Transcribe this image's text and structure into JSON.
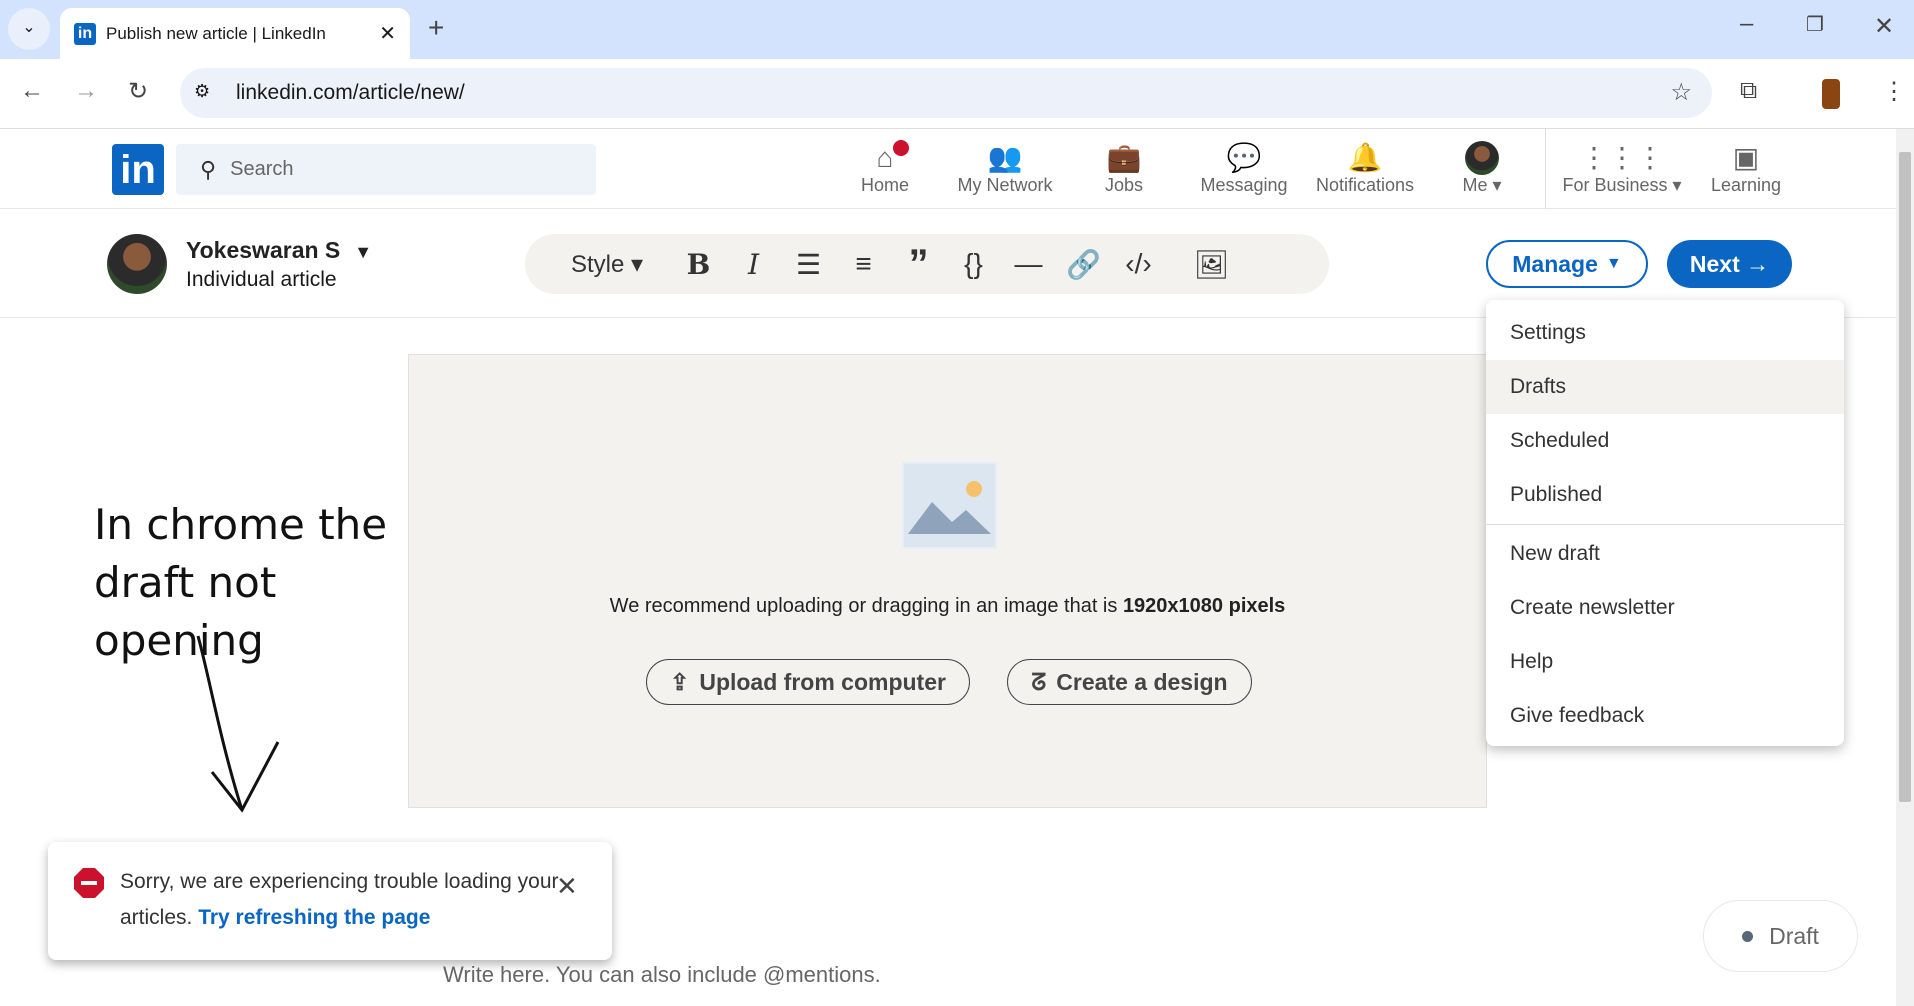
{
  "browser": {
    "tab_title": "Publish new article | LinkedIn",
    "url": "linkedin.com/article/new/"
  },
  "nav": {
    "search_placeholder": "Search",
    "items": [
      {
        "label": "Home"
      },
      {
        "label": "My Network"
      },
      {
        "label": "Jobs"
      },
      {
        "label": "Messaging"
      },
      {
        "label": "Notifications"
      },
      {
        "label": "Me"
      },
      {
        "label": "For Business"
      },
      {
        "label": "Learning"
      }
    ]
  },
  "author": {
    "name": "Yokeswaran S",
    "type": "Individual article"
  },
  "toolbar": {
    "style_label": "Style"
  },
  "actions": {
    "manage": "Manage",
    "next": "Next"
  },
  "manage_menu": [
    "Settings",
    "Drafts",
    "Scheduled",
    "Published",
    "New draft",
    "Create newsletter",
    "Help",
    "Give feedback"
  ],
  "image_area": {
    "recommend_text": "We recommend uploading or dragging in an image that is ",
    "recommend_size": "1920x1080 pixels",
    "upload": "Upload from computer",
    "design": "Create a design"
  },
  "annotation": [
    "In chrome the",
    "draft not",
    "opening"
  ],
  "toast": {
    "message": "Sorry, we are experiencing trouble loading your articles. ",
    "link": "Try refreshing the page"
  },
  "editor": {
    "placeholder": "Write here. You can also include @mentions."
  },
  "status": {
    "label": "Draft"
  },
  "colors": {
    "brand": "#0a66c2",
    "error": "#cb112d"
  }
}
